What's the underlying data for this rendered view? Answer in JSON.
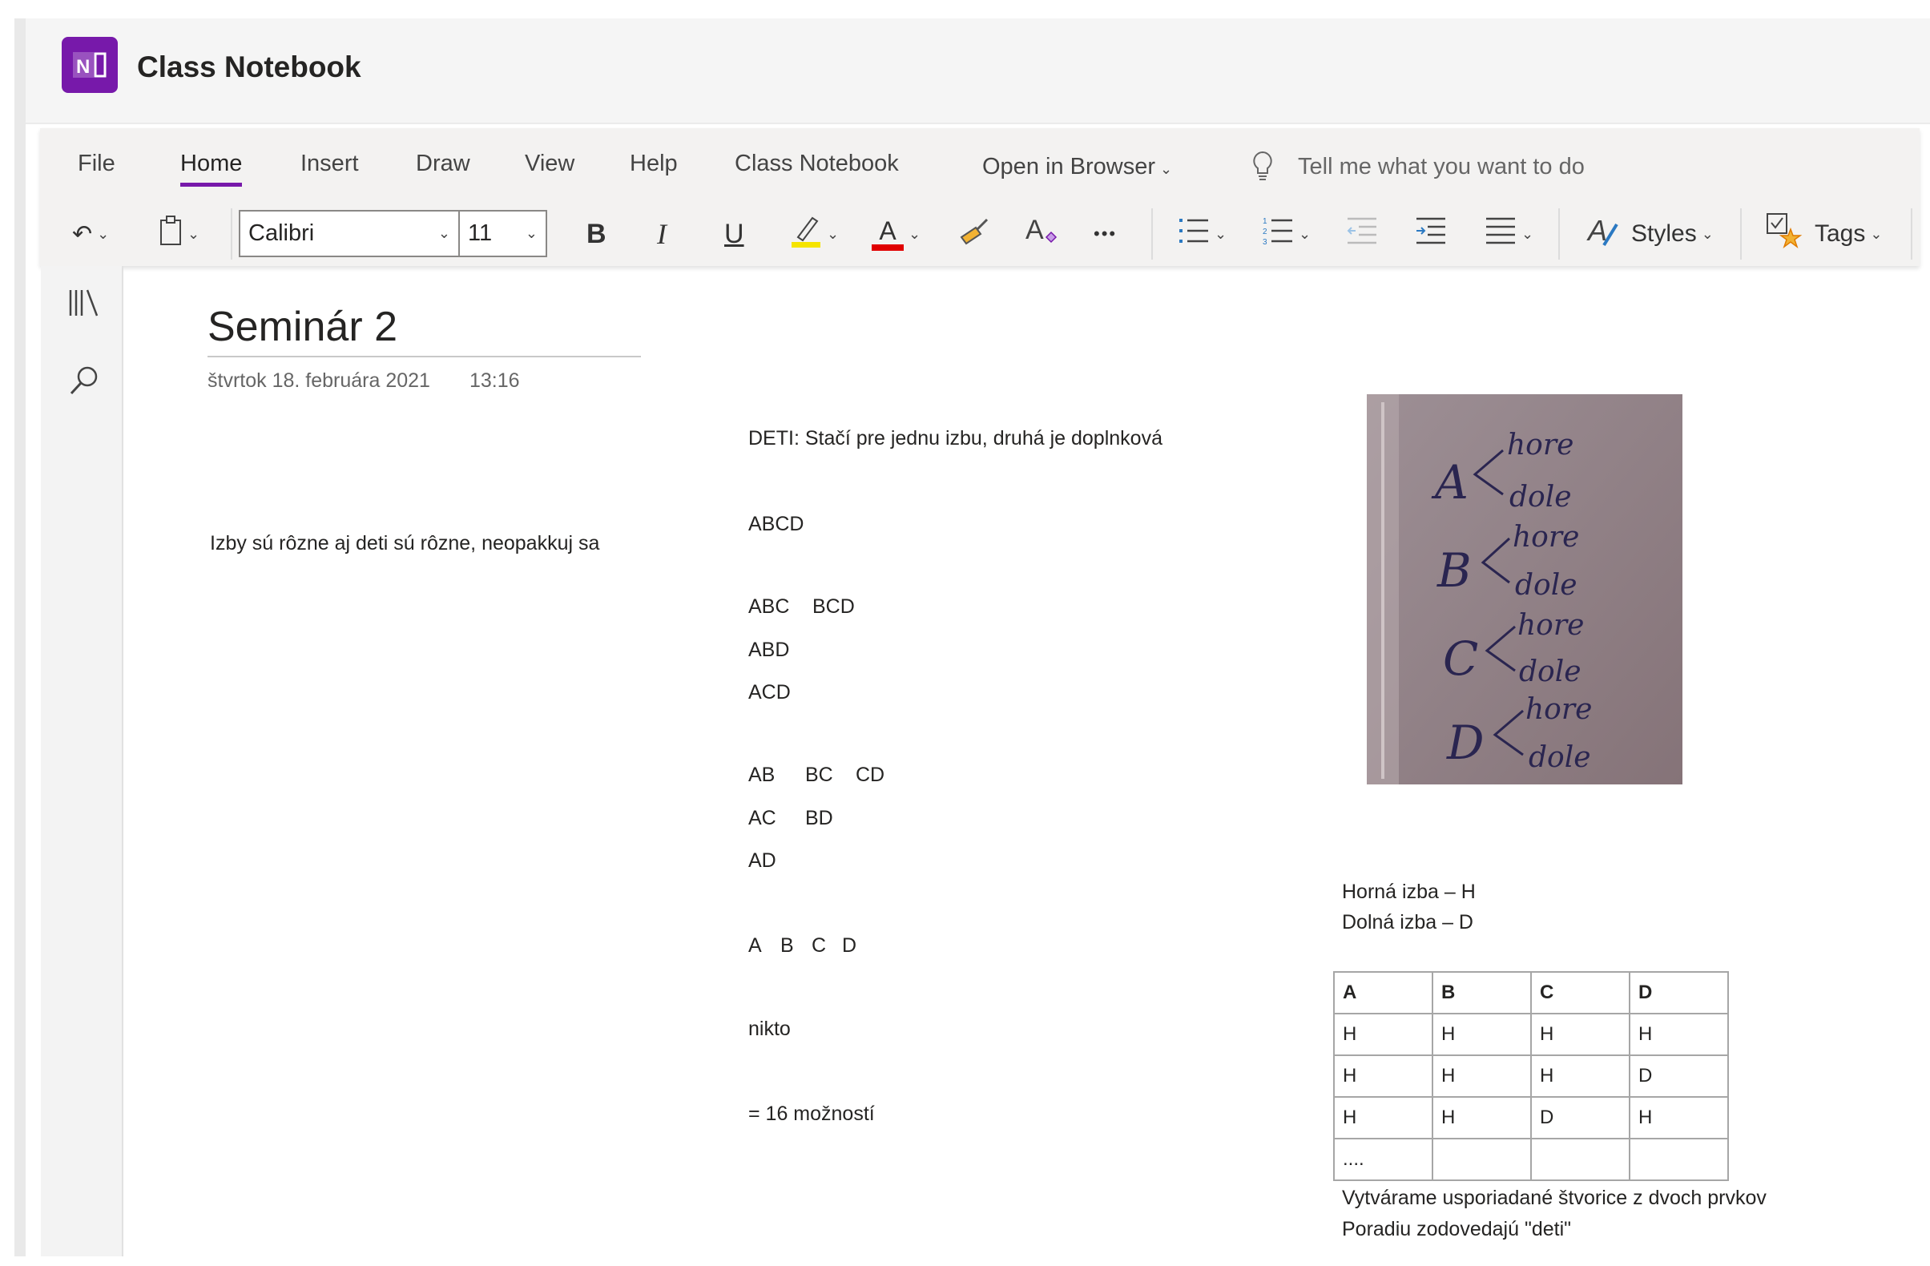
{
  "app": {
    "title": "Class Notebook",
    "logo_text": "N"
  },
  "ribbon": {
    "tabs": [
      "File",
      "Home",
      "Insert",
      "Draw",
      "View",
      "Help",
      "Class Notebook"
    ],
    "active_tab": "Home",
    "open_in_browser": "Open in Browser",
    "tell_me_placeholder": "Tell me what you want to do",
    "font_name": "Calibri",
    "font_size": "11",
    "bold": "B",
    "italic": "I",
    "underline": "U",
    "font_color_glyph": "A",
    "more": "•••",
    "styles": "Styles",
    "tags": "Tags",
    "colors": {
      "highlight": "#f5e400",
      "font_color": "#e00000",
      "accent": "#7719aa"
    }
  },
  "page": {
    "title": "Seminár 2",
    "date": "štvrtok 18. februára 2021",
    "time": "13:16",
    "left_note": "Izby sú rôzne aj deti sú rôzne, neopakkuj sa",
    "middle": {
      "deti": "DETI: Stačí pre jednu izbu, druhá je doplnková",
      "abcd": "ABCD",
      "triples": [
        "ABC",
        "BCD",
        "ABD",
        "ACD"
      ],
      "pairs": [
        "AB",
        "BC",
        "CD",
        "AC",
        "BD",
        "AD"
      ],
      "singles": [
        "A",
        "B",
        "C",
        "D"
      ],
      "nikto": "nikto",
      "total": "= 16 možností"
    },
    "photo_handwriting": {
      "letters": [
        "A",
        "B",
        "C",
        "D"
      ],
      "hore": "hore",
      "dole": "dole"
    },
    "legend": [
      "Horná izba – H",
      "Dolná izba – D"
    ],
    "table": {
      "header": [
        "A",
        "B",
        "C",
        "D"
      ],
      "rows": [
        [
          "H",
          "H",
          "H",
          "H"
        ],
        [
          "H",
          "H",
          "H",
          "D"
        ],
        [
          "H",
          "H",
          "D",
          "H"
        ],
        [
          "....",
          "",
          "",
          ""
        ]
      ]
    },
    "footer": [
      "Vytvárame usporiadané štvorice z dvoch prvkov",
      "Poradiu zodovedajú \"deti\""
    ]
  }
}
